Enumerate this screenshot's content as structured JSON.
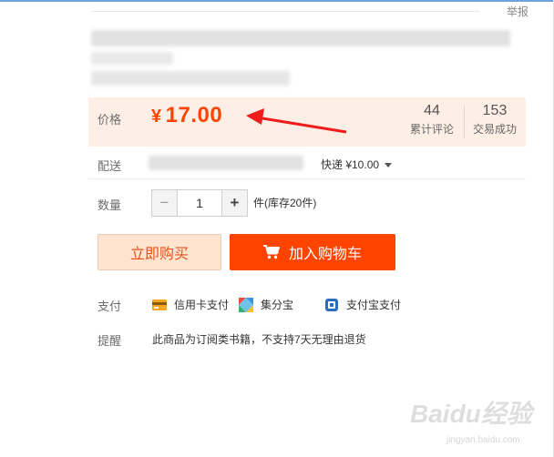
{
  "header": {
    "report_label": "举报"
  },
  "price": {
    "label": "价格",
    "currency": "¥",
    "value": "17.00",
    "reviews_count": "44",
    "reviews_label": "累计评论",
    "deals_count": "153",
    "deals_label": "交易成功"
  },
  "shipping": {
    "label": "配送",
    "method": "快递 ¥10.00"
  },
  "quantity": {
    "label": "数量",
    "minus": "−",
    "value": "1",
    "plus": "+",
    "stock": "件(库存20件)"
  },
  "actions": {
    "buy_now": "立即购买",
    "add_to_cart": "加入购物车"
  },
  "payment": {
    "label": "支付",
    "methods": [
      "信用卡支付",
      "集分宝",
      "支付宝支付"
    ]
  },
  "reminder": {
    "label": "提醒",
    "text": "此商品为订阅类书籍，不支持7天无理由退货"
  },
  "watermark": {
    "logo": "Baidu经验",
    "url": "jingyan.baidu.com"
  },
  "colors": {
    "accent": "#ff4400",
    "price_bg": "#fdefe6",
    "buy_now_bg": "#ffe4d0"
  }
}
